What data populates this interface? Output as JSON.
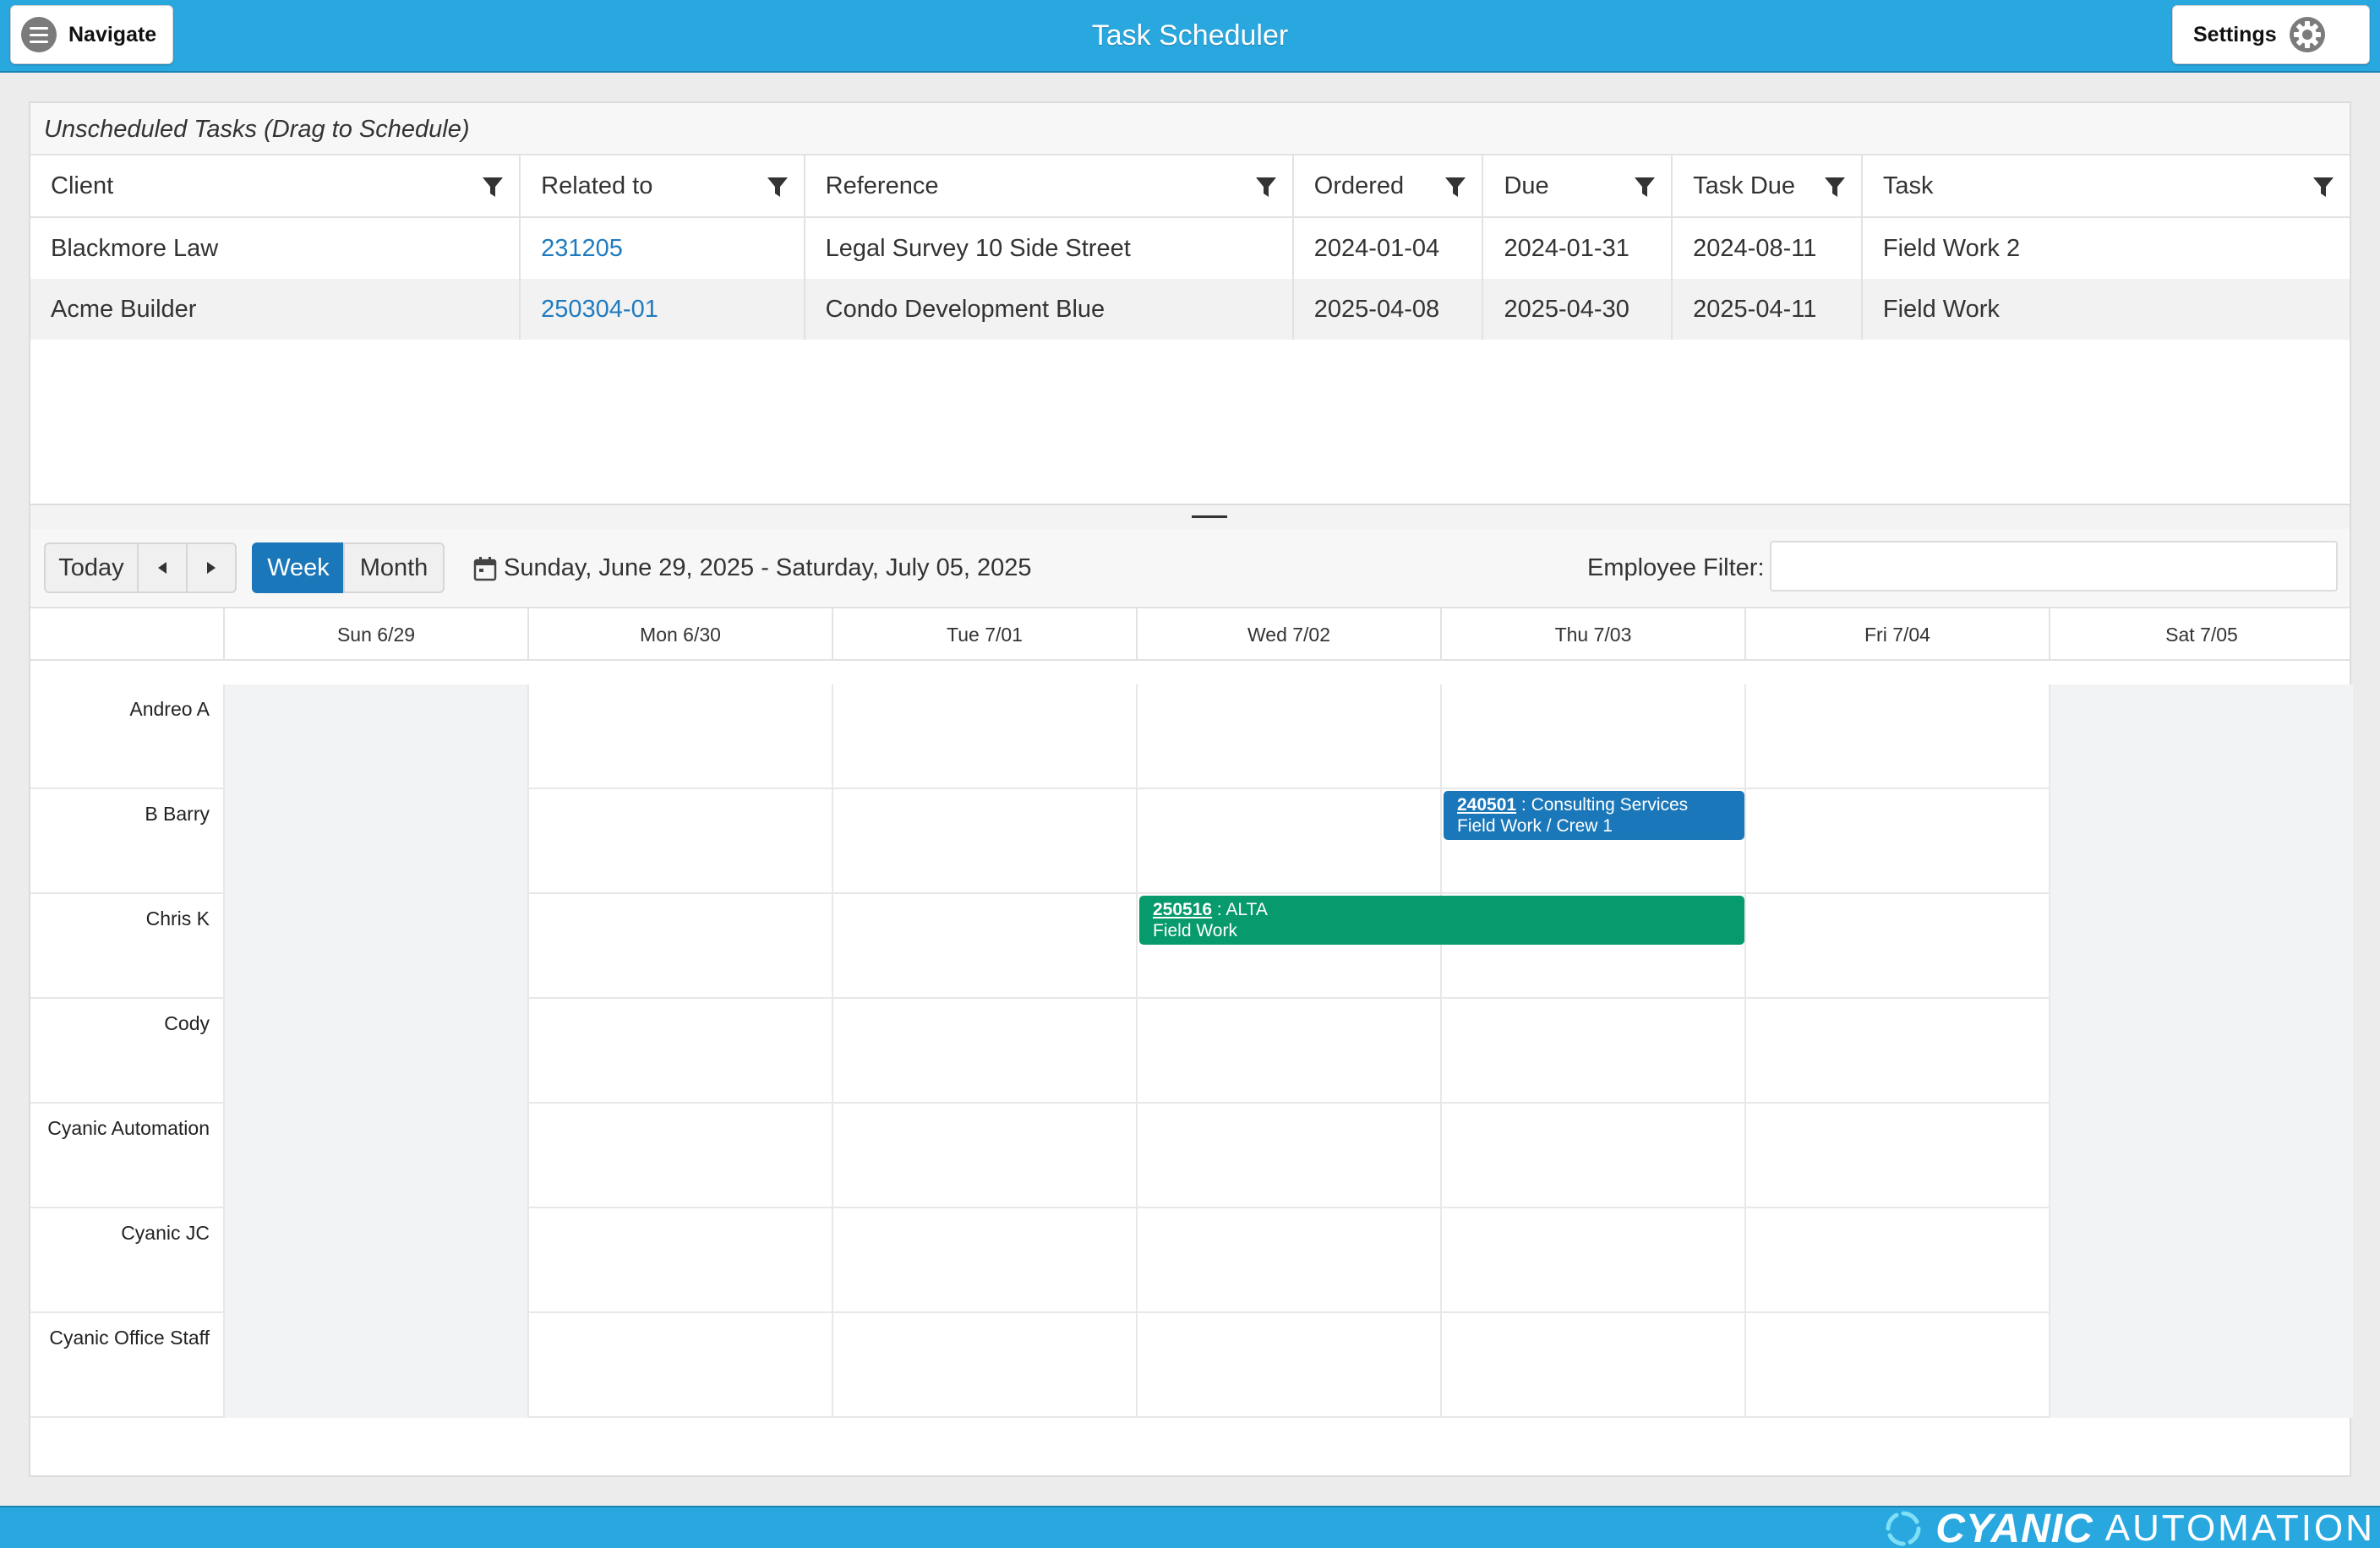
{
  "header": {
    "navigate_label": "Navigate",
    "title": "Task Scheduler",
    "settings_label": "Settings"
  },
  "unscheduled": {
    "title": "Unscheduled Tasks (Drag to Schedule)",
    "columns": [
      "Client",
      "Related to",
      "Reference",
      "Ordered",
      "Due",
      "Task Due",
      "Task"
    ],
    "rows": [
      {
        "client": "Blackmore Law",
        "related": "231205",
        "reference": "Legal Survey 10 Side Street",
        "ordered": "2024-01-04",
        "due": "2024-01-31",
        "task_due": "2024-08-11",
        "task": "Field Work 2"
      },
      {
        "client": "Acme Builder",
        "related": "250304-01",
        "reference": "Condo Development Blue",
        "ordered": "2025-04-08",
        "due": "2025-04-30",
        "task_due": "2025-04-11",
        "task": "Field Work"
      }
    ]
  },
  "toolbar": {
    "today_label": "Today",
    "week_label": "Week",
    "month_label": "Month",
    "date_range": "Sunday, June 29, 2025 - Saturday, July 05, 2025",
    "employee_filter_label": "Employee Filter:",
    "employee_filter_value": ""
  },
  "days": [
    {
      "label": "Sun 6/29",
      "weekend": true
    },
    {
      "label": "Mon 6/30",
      "weekend": false
    },
    {
      "label": "Tue 7/01",
      "weekend": false
    },
    {
      "label": "Wed 7/02",
      "weekend": false
    },
    {
      "label": "Thu 7/03",
      "weekend": false
    },
    {
      "label": "Fri 7/04",
      "weekend": false
    },
    {
      "label": "Sat 7/05",
      "weekend": true
    }
  ],
  "employees": [
    "Andreo A",
    "B Barry",
    "Chris K",
    "Cody",
    "Cyanic Automation",
    "Cyanic JC",
    "Cyanic Office Staff"
  ],
  "events": [
    {
      "id": "240501",
      "title": " : Consulting Services",
      "subtitle": "Field Work / Crew 1",
      "employee": "B Barry",
      "start_day": "Thu 7/03",
      "end_day": "Thu 7/03",
      "color": "#1a77b9"
    },
    {
      "id": "250516",
      "title": " : ALTA",
      "subtitle": "Field Work",
      "employee": "Chris K",
      "start_day": "Wed 7/02",
      "end_day": "Thu 7/03",
      "color": "#079a6c"
    }
  ],
  "footer": {
    "brand_primary": "CYANIC",
    "brand_secondary": "AUTOMATION"
  },
  "colors": {
    "header_bg": "#29a8e0",
    "accent": "#1a77b9",
    "link": "#1f7bbf",
    "event_green": "#079a6c"
  }
}
